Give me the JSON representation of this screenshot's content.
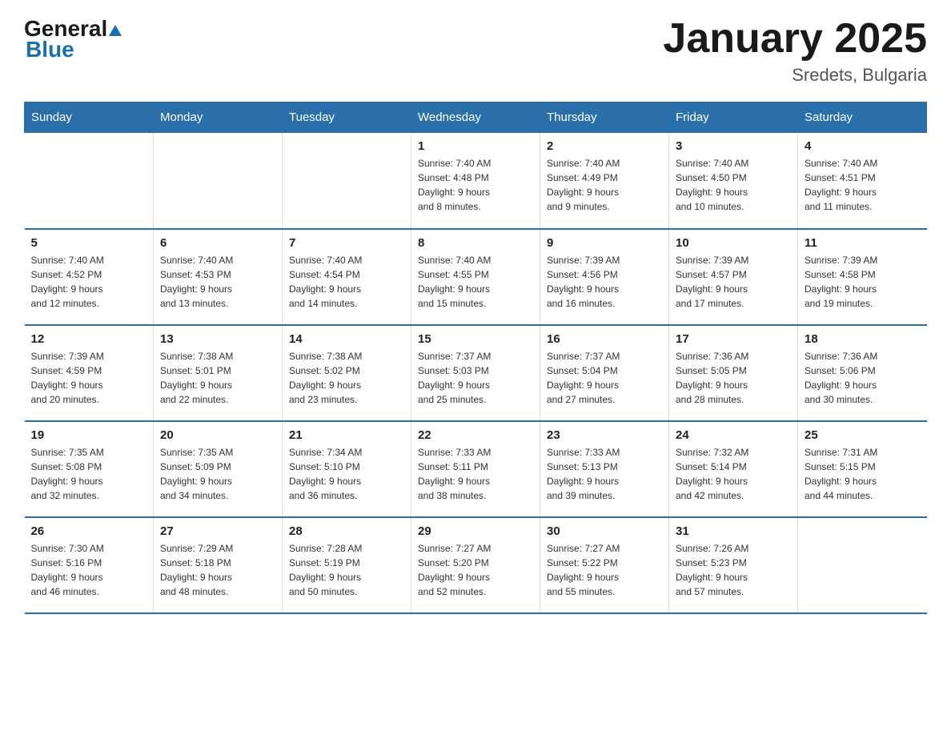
{
  "header": {
    "logo_general": "General",
    "logo_blue": "Blue",
    "title": "January 2025",
    "subtitle": "Sredets, Bulgaria"
  },
  "days_of_week": [
    "Sunday",
    "Monday",
    "Tuesday",
    "Wednesday",
    "Thursday",
    "Friday",
    "Saturday"
  ],
  "weeks": [
    [
      {
        "day": "",
        "info": ""
      },
      {
        "day": "",
        "info": ""
      },
      {
        "day": "",
        "info": ""
      },
      {
        "day": "1",
        "info": "Sunrise: 7:40 AM\nSunset: 4:48 PM\nDaylight: 9 hours\nand 8 minutes."
      },
      {
        "day": "2",
        "info": "Sunrise: 7:40 AM\nSunset: 4:49 PM\nDaylight: 9 hours\nand 9 minutes."
      },
      {
        "day": "3",
        "info": "Sunrise: 7:40 AM\nSunset: 4:50 PM\nDaylight: 9 hours\nand 10 minutes."
      },
      {
        "day": "4",
        "info": "Sunrise: 7:40 AM\nSunset: 4:51 PM\nDaylight: 9 hours\nand 11 minutes."
      }
    ],
    [
      {
        "day": "5",
        "info": "Sunrise: 7:40 AM\nSunset: 4:52 PM\nDaylight: 9 hours\nand 12 minutes."
      },
      {
        "day": "6",
        "info": "Sunrise: 7:40 AM\nSunset: 4:53 PM\nDaylight: 9 hours\nand 13 minutes."
      },
      {
        "day": "7",
        "info": "Sunrise: 7:40 AM\nSunset: 4:54 PM\nDaylight: 9 hours\nand 14 minutes."
      },
      {
        "day": "8",
        "info": "Sunrise: 7:40 AM\nSunset: 4:55 PM\nDaylight: 9 hours\nand 15 minutes."
      },
      {
        "day": "9",
        "info": "Sunrise: 7:39 AM\nSunset: 4:56 PM\nDaylight: 9 hours\nand 16 minutes."
      },
      {
        "day": "10",
        "info": "Sunrise: 7:39 AM\nSunset: 4:57 PM\nDaylight: 9 hours\nand 17 minutes."
      },
      {
        "day": "11",
        "info": "Sunrise: 7:39 AM\nSunset: 4:58 PM\nDaylight: 9 hours\nand 19 minutes."
      }
    ],
    [
      {
        "day": "12",
        "info": "Sunrise: 7:39 AM\nSunset: 4:59 PM\nDaylight: 9 hours\nand 20 minutes."
      },
      {
        "day": "13",
        "info": "Sunrise: 7:38 AM\nSunset: 5:01 PM\nDaylight: 9 hours\nand 22 minutes."
      },
      {
        "day": "14",
        "info": "Sunrise: 7:38 AM\nSunset: 5:02 PM\nDaylight: 9 hours\nand 23 minutes."
      },
      {
        "day": "15",
        "info": "Sunrise: 7:37 AM\nSunset: 5:03 PM\nDaylight: 9 hours\nand 25 minutes."
      },
      {
        "day": "16",
        "info": "Sunrise: 7:37 AM\nSunset: 5:04 PM\nDaylight: 9 hours\nand 27 minutes."
      },
      {
        "day": "17",
        "info": "Sunrise: 7:36 AM\nSunset: 5:05 PM\nDaylight: 9 hours\nand 28 minutes."
      },
      {
        "day": "18",
        "info": "Sunrise: 7:36 AM\nSunset: 5:06 PM\nDaylight: 9 hours\nand 30 minutes."
      }
    ],
    [
      {
        "day": "19",
        "info": "Sunrise: 7:35 AM\nSunset: 5:08 PM\nDaylight: 9 hours\nand 32 minutes."
      },
      {
        "day": "20",
        "info": "Sunrise: 7:35 AM\nSunset: 5:09 PM\nDaylight: 9 hours\nand 34 minutes."
      },
      {
        "day": "21",
        "info": "Sunrise: 7:34 AM\nSunset: 5:10 PM\nDaylight: 9 hours\nand 36 minutes."
      },
      {
        "day": "22",
        "info": "Sunrise: 7:33 AM\nSunset: 5:11 PM\nDaylight: 9 hours\nand 38 minutes."
      },
      {
        "day": "23",
        "info": "Sunrise: 7:33 AM\nSunset: 5:13 PM\nDaylight: 9 hours\nand 39 minutes."
      },
      {
        "day": "24",
        "info": "Sunrise: 7:32 AM\nSunset: 5:14 PM\nDaylight: 9 hours\nand 42 minutes."
      },
      {
        "day": "25",
        "info": "Sunrise: 7:31 AM\nSunset: 5:15 PM\nDaylight: 9 hours\nand 44 minutes."
      }
    ],
    [
      {
        "day": "26",
        "info": "Sunrise: 7:30 AM\nSunset: 5:16 PM\nDaylight: 9 hours\nand 46 minutes."
      },
      {
        "day": "27",
        "info": "Sunrise: 7:29 AM\nSunset: 5:18 PM\nDaylight: 9 hours\nand 48 minutes."
      },
      {
        "day": "28",
        "info": "Sunrise: 7:28 AM\nSunset: 5:19 PM\nDaylight: 9 hours\nand 50 minutes."
      },
      {
        "day": "29",
        "info": "Sunrise: 7:27 AM\nSunset: 5:20 PM\nDaylight: 9 hours\nand 52 minutes."
      },
      {
        "day": "30",
        "info": "Sunrise: 7:27 AM\nSunset: 5:22 PM\nDaylight: 9 hours\nand 55 minutes."
      },
      {
        "day": "31",
        "info": "Sunrise: 7:26 AM\nSunset: 5:23 PM\nDaylight: 9 hours\nand 57 minutes."
      },
      {
        "day": "",
        "info": ""
      }
    ]
  ]
}
